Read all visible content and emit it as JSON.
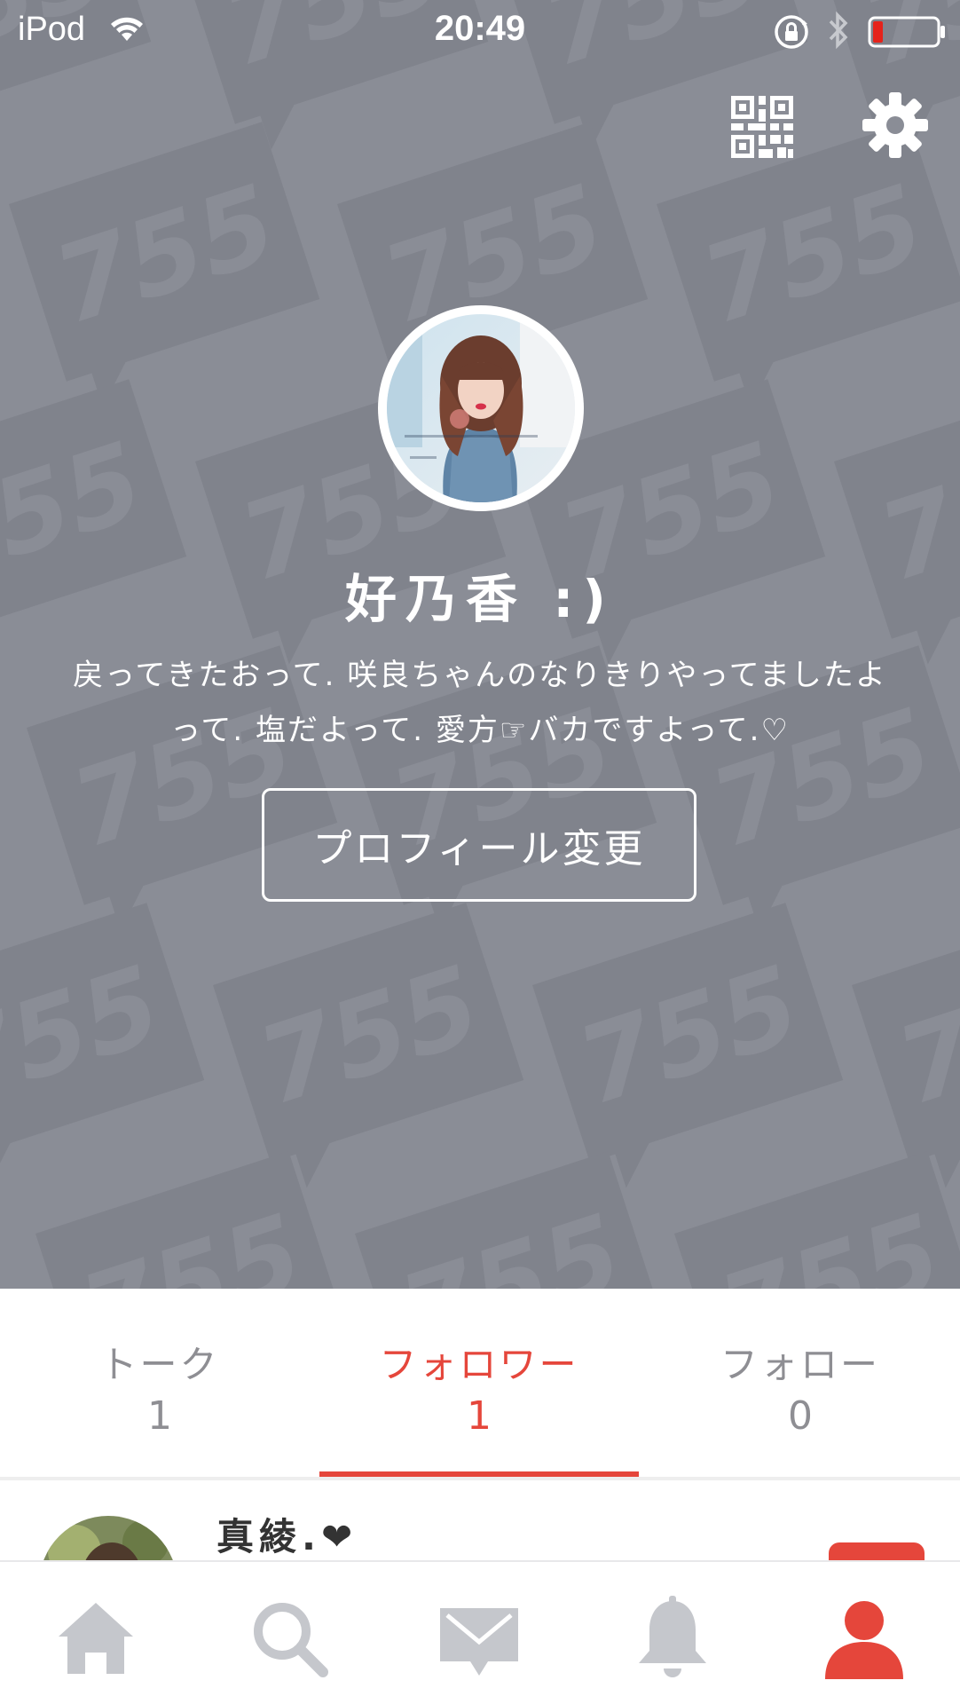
{
  "status_bar": {
    "carrier": "iPod",
    "time": "20:49"
  },
  "header": {
    "icons": [
      "qr-code-icon",
      "settings-gear-icon"
    ]
  },
  "profile": {
    "name": "好乃香 :)",
    "bio_line1": "戻ってきたおって. 咲良ちゃんのなりきりやってましたよ",
    "bio_line2": "って. 塩だよって. 愛方☞バカですよって.♡",
    "edit_button": "プロフィール変更",
    "background_watermark": "755"
  },
  "tabs": [
    {
      "label": "トーク",
      "count": "1",
      "active": false
    },
    {
      "label": "フォロワー",
      "count": "1",
      "active": true
    },
    {
      "label": "フォロー",
      "count": "0",
      "active": false
    }
  ],
  "list": [
    {
      "name": "真綾.❤"
    }
  ],
  "tabbar": {
    "items": [
      "home-icon",
      "search-icon",
      "message-icon",
      "bell-icon",
      "profile-icon"
    ],
    "active_index": 4
  },
  "colors": {
    "accent": "#e5463b",
    "header_bg": "#8a8d96",
    "inactive": "#8e8e93",
    "tabbar_inactive": "#c5c7cc"
  }
}
